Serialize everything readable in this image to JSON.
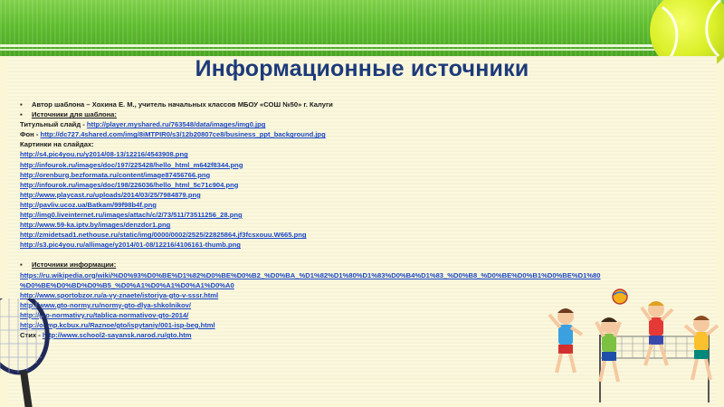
{
  "title": "Информационные источники",
  "author_line": "Автор шаблона – Хохина Е. М., учитель начальных классов МБОУ «СОШ №50» г. Калуги",
  "template_sources_heading": "Источники для шаблона:",
  "title_slide_label": "Титульный слайд - ",
  "title_slide_link": "http://player.myshared.ru/763548/data/images/img0.jpg",
  "background_label": "Фон - ",
  "background_link": "http://dc727.4shared.com/img/8iMTPIR0/s3/12b20807ce8/business_ppt_background.jpg",
  "pictures_label": "Картинки на слайдах:",
  "picture_links": [
    "http://s4.pic4you.ru/y2014/08-13/12216/4543908.png",
    "http://infourok.ru/images/doc/197/225428/hello_html_m642f8344.png",
    "http://orenburg.bezformata.ru/content/image87456766.png",
    "http://infourok.ru/images/doc/198/226036/hello_html_5c71c904.png",
    "http://www.playcast.ru/uploads/2014/03/25/7984879.png",
    "http://pavliv.ucoz.ua/Batkam/99f98b4f.png",
    "http://img0.liveinternet.ru/images/attach/c/2/73/511/73511256_28.png",
    "http://www.59-ka.iptv.by/images/denzdor1.png",
    "http://zmidetsad1.nethouse.ru/static/img/0000/0002/2525/22825864.jf3fcsxouu.W665.png",
    "http://s3.pic4you.ru/allimage/y2014/01-08/12216/4106161-thumb.png"
  ],
  "info_sources_heading": "Источники информации:",
  "info_links": [
    "https://ru.wikipedia.org/wiki/%D0%93%D0%BE%D1%82%D0%BE%D0%B2_%D0%BA_%D1%82%D1%80%D1%83%D0%B4%D1%83_%D0%B8_%D0%BE%D0%B1%D0%BE%D1%80",
    "%D0%BE%D0%BD%D0%B5_%D0%A1%D0%A1%D0%A1%D0%A0",
    "http://www.sportobzor.ru/a-vy-znaete/istoriya-gto-v-sssr.html",
    "http://www.gto-normy.ru/normy-gto-dlya-shkolnikov/",
    "http://gto-normativy.ru/tablica-normativov-gto-2014/",
    "http://olimp.kcbux.ru/Raznoe/gto/ispytaniy/001-isp-beg.html"
  ],
  "poems_label": "Стих - ",
  "poems_link": "http://www.school2-sayansk.narod.ru/gto.htm",
  "icons": {
    "bullet": "bullet-square-icon",
    "ball": "tennis-ball-icon",
    "racket": "tennis-racket-icon",
    "kids": "children-volleyball-icon"
  },
  "colors": {
    "title": "#1d3a7a",
    "link": "#1a46c8",
    "grass": "#5fbd2e",
    "paper": "#fbf8dc"
  }
}
